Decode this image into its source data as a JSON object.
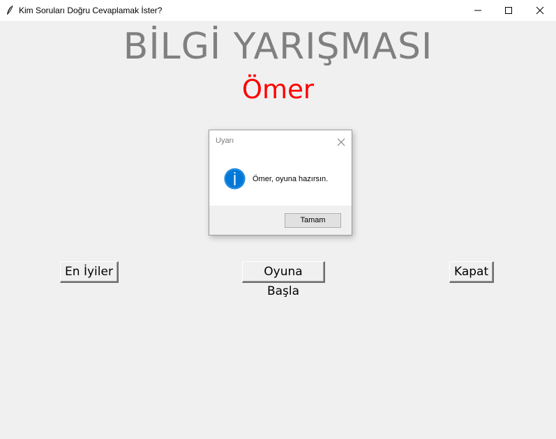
{
  "window": {
    "title": "Kim Soruları Doğru Cevaplamak İster?",
    "app_icon": "feather-icon",
    "controls": [
      "minimize-icon",
      "maximize-icon",
      "close-icon"
    ]
  },
  "main": {
    "title": "BİLGİ YARIŞMASI",
    "player_name": "Ömer",
    "title_color": "#808080",
    "player_name_color": "#ff0000",
    "buttons": {
      "best": "En İyiler",
      "start": "Oyuna Başla",
      "close": "Kapat"
    }
  },
  "dialog": {
    "title": "Uyarı",
    "icon": "info-icon",
    "icon_color": "#0078d7",
    "message": "Ömer, oyuna hazırsın.",
    "ok_label": "Tamam"
  }
}
